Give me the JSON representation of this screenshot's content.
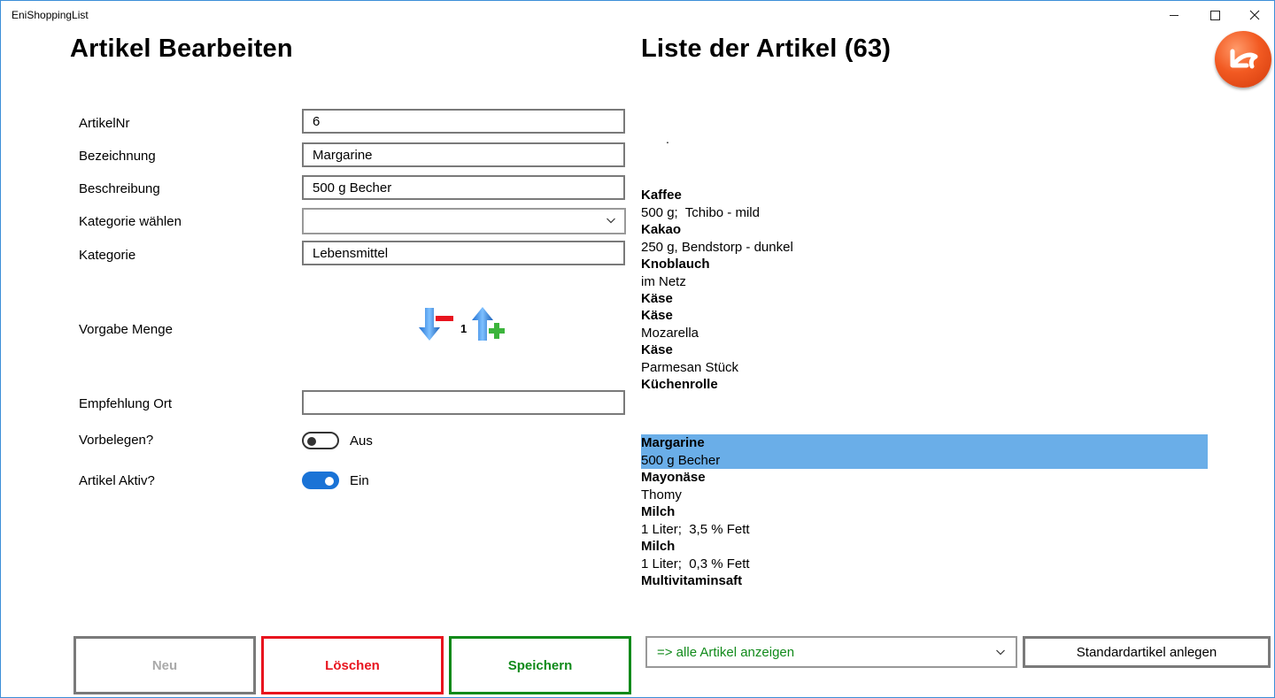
{
  "window": {
    "title": "EniShoppingList"
  },
  "colors": {
    "accent": "#1a73d6",
    "selected_row": "#6aaee8",
    "delete": "#e8141e",
    "save": "#108a1a",
    "back_button": "#f25a22"
  },
  "edit": {
    "heading": "Artikel Bearbeiten",
    "fields": {
      "artikelnr": {
        "label": "ArtikelNr",
        "value": "6"
      },
      "bezeichnung": {
        "label": "Bezeichnung",
        "value": "Margarine"
      },
      "beschreibung": {
        "label": "Beschreibung",
        "value": "500 g Becher"
      },
      "kategorie_waehlen": {
        "label": "Kategorie wählen",
        "value": ""
      },
      "kategorie": {
        "label": "Kategorie",
        "value": "Lebensmittel"
      },
      "vorgabe_menge": {
        "label": "Vorgabe Menge",
        "value": "1"
      },
      "empfehlung_ort": {
        "label": "Empfehlung Ort",
        "value": ""
      },
      "vorbelegen": {
        "label": "Vorbelegen?",
        "state": "Aus"
      },
      "artikel_aktiv": {
        "label": "Artikel Aktiv?",
        "state": "Ein"
      }
    }
  },
  "list": {
    "heading": "Liste der Artikel (63)",
    "leading_mark": ".",
    "items": [
      {
        "name": "Kaffee",
        "desc": "500 g;  Tchibo - mild"
      },
      {
        "name": "Kakao",
        "desc": "250 g, Bendstorp - dunkel"
      },
      {
        "name": "Knoblauch",
        "desc": "im Netz"
      },
      {
        "name": "Käse",
        "desc": ""
      },
      {
        "name": "Käse",
        "desc": "Mozarella"
      },
      {
        "name": "Käse",
        "desc": "Parmesan Stück"
      },
      {
        "name": "Küchenrolle",
        "desc": ""
      },
      {
        "name": "Margarine",
        "desc": "500 g Becher",
        "selected": true
      },
      {
        "name": "Mayonäse",
        "desc": "Thomy"
      },
      {
        "name": "Milch",
        "desc": "1 Liter;  3,5 % Fett"
      },
      {
        "name": "Milch",
        "desc": "1 Liter;  0,3 % Fett"
      },
      {
        "name": "Multivitaminsaft",
        "desc": ""
      }
    ]
  },
  "buttons": {
    "neu": "Neu",
    "loeschen": "Löschen",
    "speichern": "Speichern",
    "filter": "=> alle Artikel anzeigen",
    "standardartikel": "Standardartikel anlegen"
  }
}
